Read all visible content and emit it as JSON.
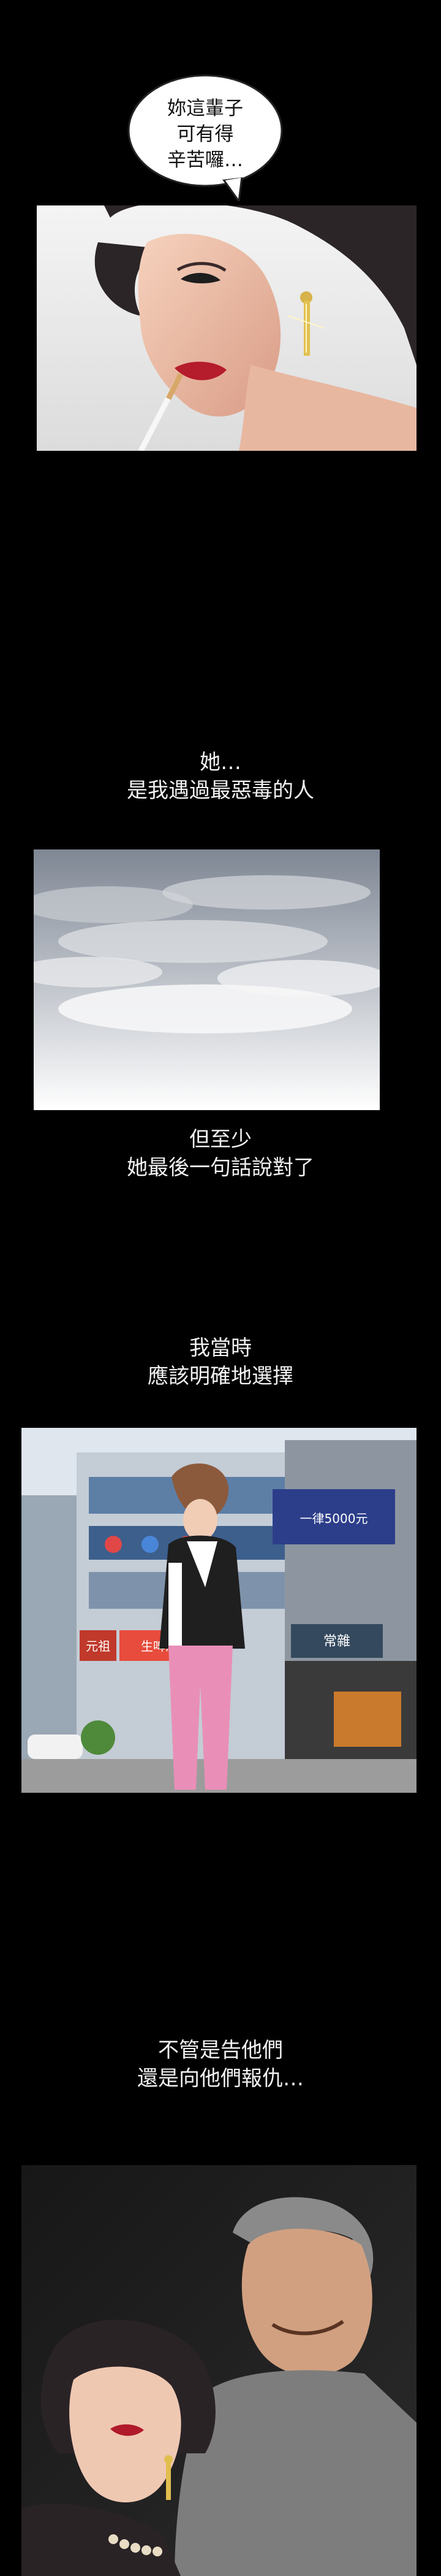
{
  "panels": {
    "panel1": {
      "speech": [
        "妳這輩子",
        "可有得",
        "辛苦囉…"
      ]
    },
    "caption1": [
      "她…",
      "是我遇過最惡毒的人"
    ],
    "caption2": [
      "但至少",
      "她最後一句話說對了"
    ],
    "caption3": [
      "我當時",
      "應該明確地選擇"
    ],
    "panel4": {
      "signs": [
        "元祖",
        "生啤酒屋",
        "一律5000元",
        "常雜"
      ]
    },
    "caption4": [
      "不管是告他們",
      "還是向他們報仇…"
    ]
  }
}
